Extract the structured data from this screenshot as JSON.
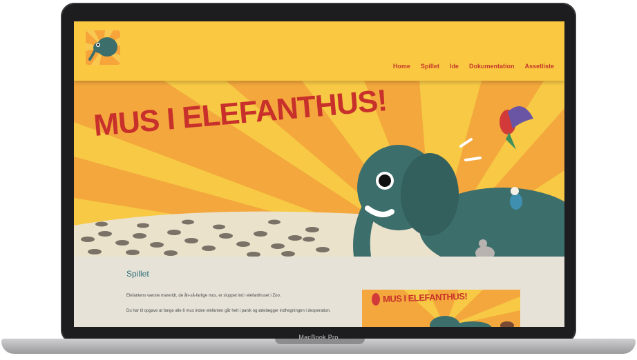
{
  "site": {
    "nav": [
      "Home",
      "Spillet",
      "Ide",
      "Dokumentation",
      "Assetliste"
    ]
  },
  "hero": {
    "title": "MUS I ELEFANTHUS!"
  },
  "content": {
    "heading": "Spillet",
    "paragraph1": "Elefantens værste mareridt, de åh-så-farlige mus, er sluppet ind i elefanthuset i Zoo.",
    "paragraph2": "Du har til opgave at fange alle 6 mus inden elefanten går helt i panik og ødelægger indhegningen i desperation.",
    "thumbnail_title": "MUS I ELEFANTHUS!"
  },
  "device": {
    "label": "MacBook Pro"
  },
  "colors": {
    "header_bg": "#fbc842",
    "nav_text": "#c43a2a",
    "heading": "#2f6f77",
    "page_bg": "#e6e2d8",
    "elephant": "#3c6e6c"
  }
}
